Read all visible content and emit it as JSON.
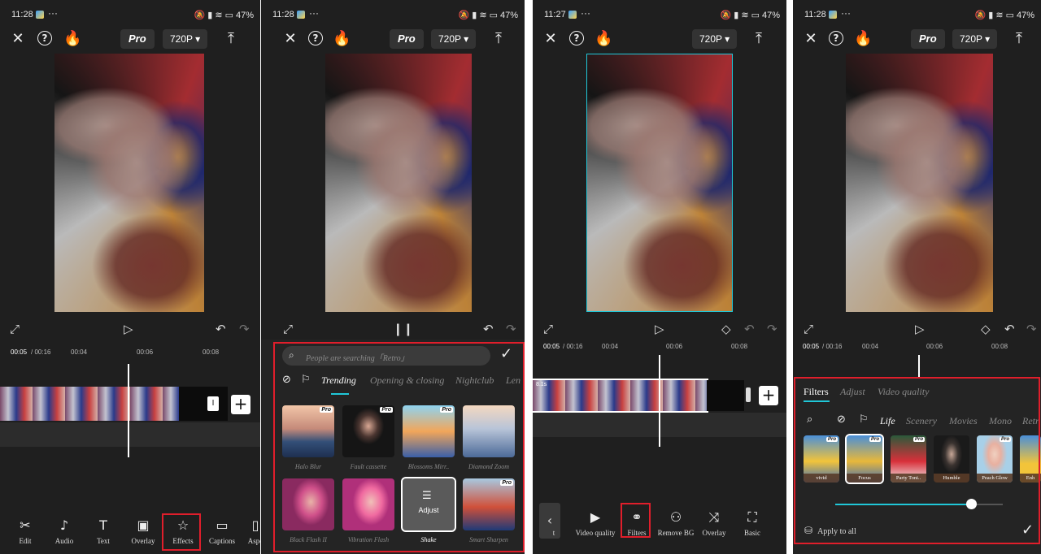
{
  "status": {
    "panels": [
      {
        "time": "11:28",
        "battery": "47%"
      },
      {
        "time": "11:28",
        "battery": "47%"
      },
      {
        "time": "11:27",
        "battery": "47%"
      },
      {
        "time": "11:28",
        "battery": "47%"
      }
    ]
  },
  "topbar": {
    "pro_label": "Pro",
    "resolution": "720P ▾"
  },
  "timeline": {
    "current_time": "00:05",
    "total_time": "/ 00:16",
    "ticks": [
      "00:04",
      "00:06",
      "00:08"
    ],
    "clip_label": "8.1s"
  },
  "panel1": {
    "tools": [
      {
        "icon": "scissors-icon",
        "label": "Edit"
      },
      {
        "icon": "music-note-icon",
        "label": "Audio"
      },
      {
        "icon": "text-icon",
        "label": "Text"
      },
      {
        "icon": "overlay-icon",
        "label": "Overlay"
      },
      {
        "icon": "effects-star-icon",
        "label": "Effects"
      },
      {
        "icon": "captions-icon",
        "label": "Captions"
      },
      {
        "icon": "aspect-icon",
        "label": "Aspe"
      }
    ]
  },
  "panel2": {
    "search_placeholder": "People are searching「Retro」",
    "tabs": [
      "Trending",
      "Opening & closing",
      "Nightclub",
      "Len"
    ],
    "effects": [
      {
        "label": "Halo Blur",
        "pro": true
      },
      {
        "label": "Fault cassette",
        "pro": true
      },
      {
        "label": "Blossoms Mirr..",
        "pro": true
      },
      {
        "label": "Diamond Zoom",
        "pro": false
      },
      {
        "label": "Black Flash II",
        "pro": false
      },
      {
        "label": "Vibration Flash",
        "pro": false
      },
      {
        "label": "Shake",
        "pro": false,
        "selected": true,
        "overlay": "Adjust"
      },
      {
        "label": "Smart Sharpen",
        "pro": true
      }
    ]
  },
  "panel3": {
    "tools": [
      {
        "icon": "partial-icon",
        "label": "t"
      },
      {
        "icon": "hd-icon",
        "label": "Video quality"
      },
      {
        "icon": "filters-icon",
        "label": "Filters"
      },
      {
        "icon": "person-icon",
        "label": "Remove BG"
      },
      {
        "icon": "shuffle-icon",
        "label": "Overlay"
      },
      {
        "icon": "crop-frame-icon",
        "label": "Basic"
      }
    ]
  },
  "panel4": {
    "tabs": [
      "Filters",
      "Adjust",
      "Video quality"
    ],
    "categories": [
      "Life",
      "Scenery",
      "Movies",
      "Mono",
      "Retr"
    ],
    "filters": [
      {
        "label": "vivid",
        "pro": true
      },
      {
        "label": "Focus",
        "pro": true,
        "selected": true
      },
      {
        "label": "Party Toni..",
        "pro": true
      },
      {
        "label": "Humble",
        "pro": false
      },
      {
        "label": "Peach Glow",
        "pro": true
      },
      {
        "label": "Enh",
        "pro": false
      }
    ],
    "intensity": 0.81,
    "apply_all": "Apply to all"
  },
  "colors": {
    "accent": "#20c7d8",
    "highlight": "#e01e2b",
    "background": "#1f1f1f"
  }
}
